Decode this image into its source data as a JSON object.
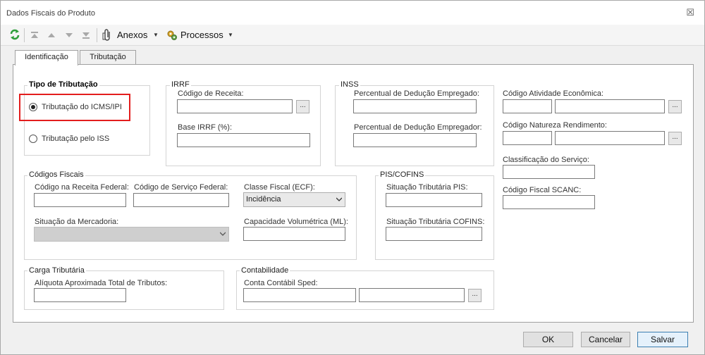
{
  "window": {
    "title": "Dados Fiscais do Produto",
    "close_glyph": "☒"
  },
  "toolbar": {
    "anexos_label": "Anexos",
    "processos_label": "Processos"
  },
  "tabs": [
    {
      "label": "Identificação",
      "active": true
    },
    {
      "label": "Tributação",
      "active": false
    }
  ],
  "tipo_tributacao": {
    "legend": "Tipo de Tributação",
    "options": [
      {
        "label": "Tributação do ICMS/IPI",
        "checked": true
      },
      {
        "label": "Tributação pelo ISS",
        "checked": false
      }
    ]
  },
  "irrf": {
    "legend": "IRRF",
    "codigo_receita_label": "Código de Receita:",
    "codigo_receita_value": "",
    "base_irrf_label": "Base IRRF (%):",
    "base_irrf_value": ""
  },
  "inss": {
    "legend": "INSS",
    "empregado_label": "Percentual de Dedução Empregado:",
    "empregador_label": "Percentual de Dedução Empregador:"
  },
  "right_fields": {
    "atividade_label": "Código Atividade Econômica:",
    "natureza_label": "Código Natureza Rendimento:",
    "classificacao_label": "Classificação do Serviço:",
    "scanc_label": "Código Fiscal SCANC:"
  },
  "codigos_fiscais": {
    "legend": "Códigos Fiscais",
    "receita_federal_label": "Código na Receita Federal:",
    "servico_federal_label": "Código de Serviço Federal:",
    "classe_fiscal_label": "Classe Fiscal (ECF):",
    "classe_fiscal_value": "Incidência",
    "situacao_mercadoria_label": "Situação da Mercadoria:",
    "situacao_mercadoria_value": "",
    "capacidade_label": "Capacidade Volumétrica (ML):"
  },
  "pis_cofins": {
    "legend": "PIS/COFINS",
    "pis_label": "Situação Tributária PIS:",
    "cofins_label": "Situação Tributária COFINS:"
  },
  "carga_tributaria": {
    "legend": "Carga Tributária",
    "aliquota_label": "Alíquota Aproximada Total de Tributos:"
  },
  "contabilidade": {
    "legend": "Contabilidade",
    "conta_label": "Conta Contábil Sped:"
  },
  "browse_label": "...",
  "footer": {
    "ok": "OK",
    "cancel": "Cancelar",
    "save": "Salvar"
  },
  "colors": {
    "highlight": "#e31d1d",
    "refresh_icon": "#2e9e3a"
  }
}
